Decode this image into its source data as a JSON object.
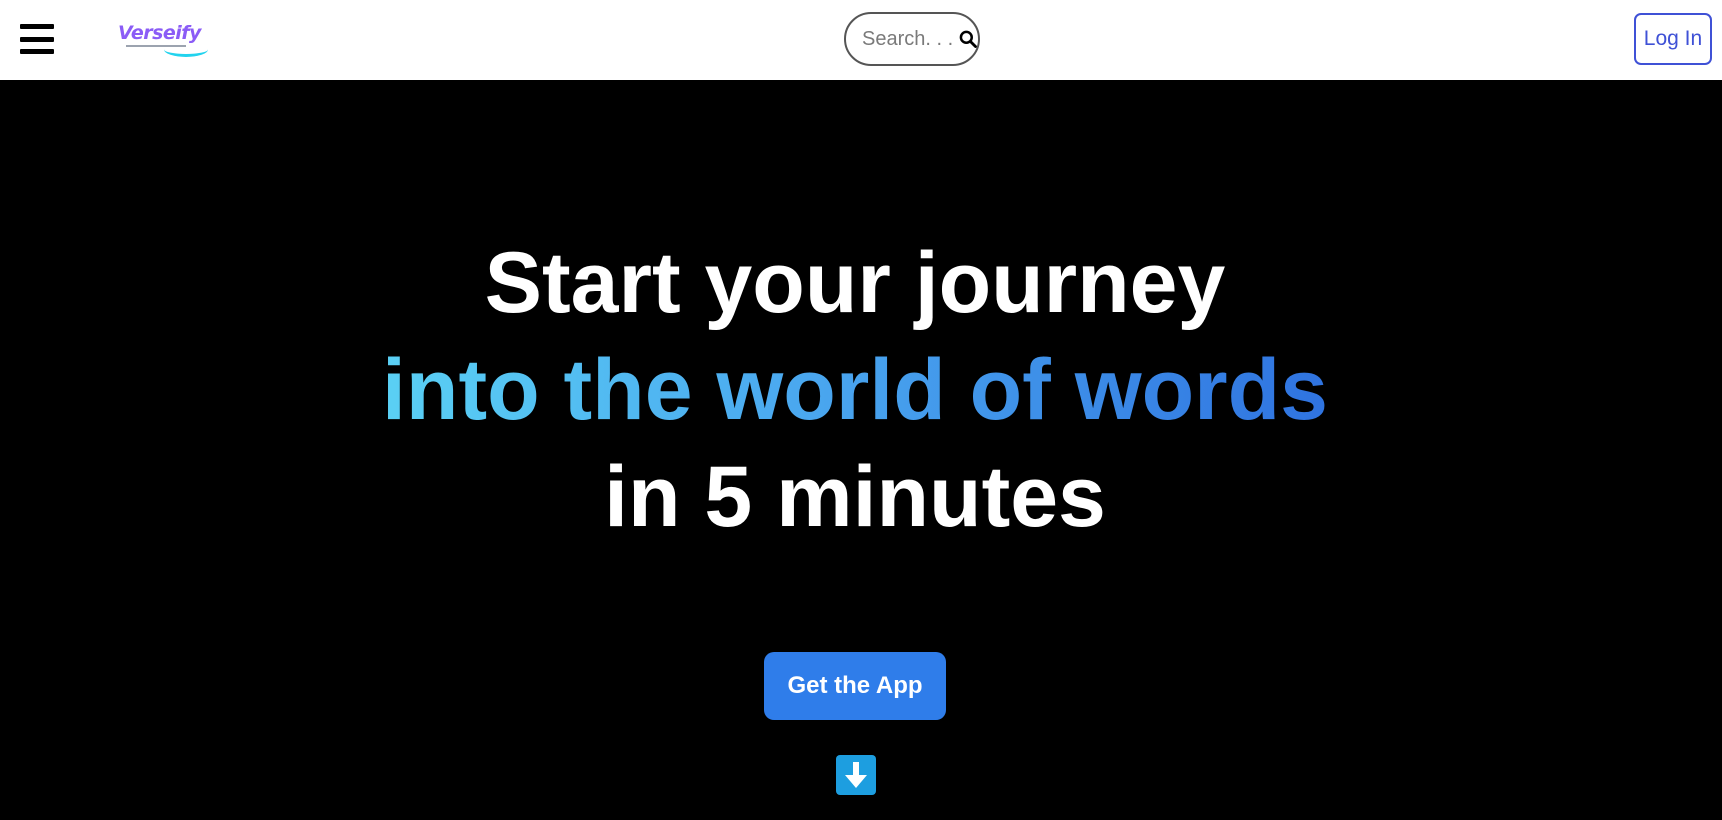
{
  "navbar": {
    "logo_text": "Verseify",
    "search": {
      "placeholder": "Search. . ."
    },
    "login_label": "Log In"
  },
  "hero": {
    "line1": "Start your journey",
    "line2": "into the world of words",
    "line3": "in 5 minutes",
    "cta_label": "Get the App"
  },
  "icons": {
    "menu": "hamburger-menu-icon",
    "search": "search-icon",
    "scroll": "arrow-down-icon"
  },
  "colors": {
    "accent": "#2f7dea",
    "login_border": "#3f51d6",
    "gradient_start": "#5ad0f4",
    "gradient_end": "#2f73e0",
    "scroll_button": "#1d9ee0",
    "logo_purple": "#8b5cf6"
  }
}
